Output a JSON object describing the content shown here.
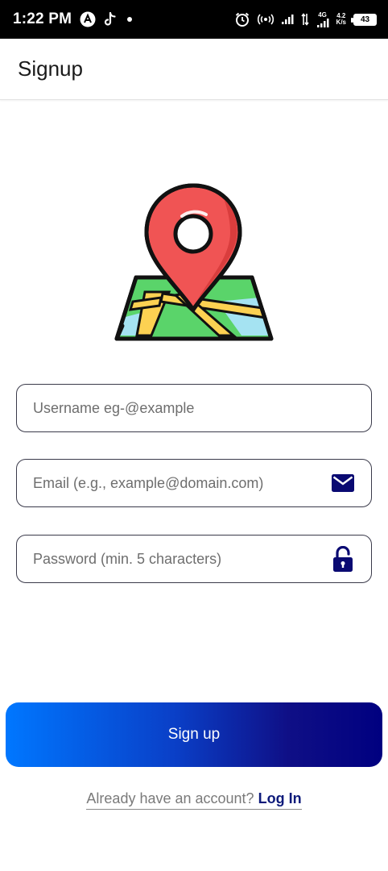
{
  "status_bar": {
    "time": "1:22 PM",
    "network_type": "4G",
    "speed_value": "4.2",
    "speed_unit": "K/s",
    "battery": "43",
    "icons": [
      "a-circle-icon",
      "tiktok-icon",
      "dot-icon",
      "alarm-icon",
      "hotspot-icon",
      "signal-icon",
      "data-arrows-icon",
      "signal-icon",
      "battery-icon"
    ]
  },
  "app_bar": {
    "title": "Signup"
  },
  "logo": {
    "icon": "map-pin-logo-icon"
  },
  "form": {
    "username_placeholder": "Username eg-@example",
    "email_placeholder": "Email (e.g., example@domain.com)",
    "password_placeholder": "Password (min. 5 characters)",
    "email_icon": "mail-icon",
    "password_icon": "unlock-icon"
  },
  "actions": {
    "signup_label": "Sign up",
    "login_question": "Already have an account?",
    "login_link": "Log In"
  },
  "colors": {
    "accent_dark": "#000080",
    "accent_light": "#0077ff",
    "link": "#0d1a7a"
  }
}
